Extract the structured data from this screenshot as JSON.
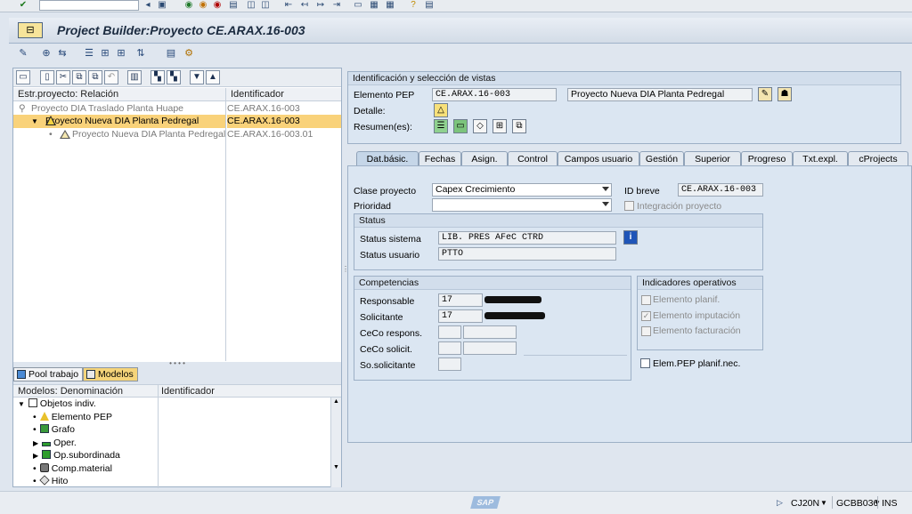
{
  "window": {
    "title": "Project Builder:Proyecto CE.ARAX.16-003"
  },
  "tree": {
    "col_relation": "Estr.proyecto: Relación",
    "col_id": "Identificador",
    "rows": [
      {
        "label": "Proyecto DIA Traslado Planta Huape",
        "id": "CE.ARAX.16-003"
      },
      {
        "label": "Proyecto Nueva DIA Planta Pedregal",
        "id": "CE.ARAX.16-003"
      },
      {
        "label": "Proyecto Nueva DIA Planta Pedregal",
        "id": "CE.ARAX.16-003.01"
      }
    ]
  },
  "bottom_tabs": {
    "pool": "Pool trabajo",
    "models": "Modelos"
  },
  "models": {
    "col_name": "Modelos: Denominación",
    "col_id": "Identificador",
    "items": [
      {
        "label": "Objetos indiv."
      },
      {
        "label": "Elemento PEP"
      },
      {
        "label": "Grafo"
      },
      {
        "label": "Oper."
      },
      {
        "label": "Op.subordinada"
      },
      {
        "label": "Comp.material"
      },
      {
        "label": "Hito"
      }
    ]
  },
  "ident": {
    "header": "Identificación y selección de vistas",
    "pep_label": "Elemento PEP",
    "pep_value": "CE.ARAX.16-003",
    "pep_desc": "Proyecto Nueva DIA Planta Pedregal",
    "detail_label": "Detalle:",
    "summary_label": "Resumen(es):"
  },
  "tabs": [
    {
      "label": "Dat.básic."
    },
    {
      "label": "Fechas"
    },
    {
      "label": "Asign."
    },
    {
      "label": "Control"
    },
    {
      "label": "Campos usuario"
    },
    {
      "label": "Gestión"
    },
    {
      "label": "Superior"
    },
    {
      "label": "Progreso"
    },
    {
      "label": "Txt.expl."
    },
    {
      "label": "cProjects"
    }
  ],
  "basic": {
    "class_label": "Clase proyecto",
    "class_value": "Capex Crecimiento",
    "short_id_label": "ID breve",
    "short_id_value": "CE.ARAX.16-003",
    "priority_label": "Prioridad",
    "priority_value": "",
    "integration_label": "Integración proyecto"
  },
  "status": {
    "header": "Status",
    "system_label": "Status sistema",
    "system_value": "LIB.  PRES AFeC CTRD",
    "user_label": "Status usuario",
    "user_value": "PTTO"
  },
  "comp": {
    "header": "Competencias",
    "responsible_label": "Responsable",
    "responsible_value": "17",
    "applicant_label": "Solicitante",
    "applicant_value": "17",
    "ceco_resp_label": "CeCo respons.",
    "ceco_applic_label": "CeCo solicit.",
    "company_label": "So.solicitante"
  },
  "indicators": {
    "header": "Indicadores operativos",
    "planning": "Elemento planif.",
    "imputation": "Elemento imputación",
    "billing": "Elemento facturación",
    "pep_planning": "Elem.PEP planif.nec."
  },
  "statusbar": {
    "logo": "SAP",
    "tcode": "CJ20N",
    "server": "GCBB036",
    "mode": "INS"
  },
  "colors": {
    "selection": "#f9d27a",
    "tab_active": "#c5d6e8",
    "panel": "#dbe6f2"
  }
}
